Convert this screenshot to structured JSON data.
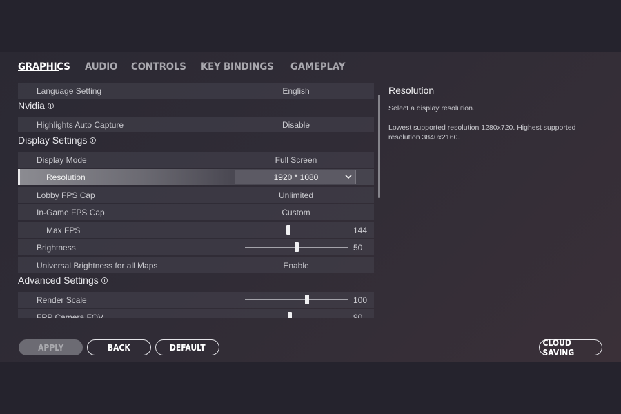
{
  "tabs": [
    {
      "label": "GRAPHICS",
      "active": true
    },
    {
      "label": "AUDIO"
    },
    {
      "label": "CONTROLS"
    },
    {
      "label": "KEY BINDINGS"
    },
    {
      "label": "GAMEPLAY"
    }
  ],
  "settings": {
    "language": {
      "label": "Language Setting",
      "value": "English"
    },
    "nvidia_header": "Nvidia",
    "highlights": {
      "label": "Highlights Auto Capture",
      "value": "Disable"
    },
    "display_header": "Display Settings",
    "display_mode": {
      "label": "Display Mode",
      "value": "Full Screen"
    },
    "resolution": {
      "label": "Resolution",
      "value": "1920 * 1080"
    },
    "lobby_fps": {
      "label": "Lobby FPS Cap",
      "value": "Unlimited"
    },
    "ingame_fps": {
      "label": "In-Game FPS Cap",
      "value": "Custom"
    },
    "max_fps": {
      "label": "Max FPS",
      "value": "144",
      "fraction": 0.42
    },
    "brightness": {
      "label": "Brightness",
      "value": "50",
      "fraction": 0.5
    },
    "universal_brightness": {
      "label": "Universal Brightness for all Maps",
      "value": "Enable"
    },
    "advanced_header": "Advanced Settings",
    "render_scale": {
      "label": "Render Scale",
      "value": "100",
      "fraction": 0.6
    },
    "fpp_fov": {
      "label": "FPP Camera FOV",
      "value": "90",
      "fraction": 0.43
    }
  },
  "detail": {
    "title": "Resolution",
    "line1": "Select a display resolution.",
    "line2": "Lowest supported resolution 1280x720. Highest supported resolution 3840x2160."
  },
  "buttons": {
    "apply": "APPLY",
    "back": "BACK",
    "default": "DEFAULT",
    "cloud": "CLOUD SAVING"
  },
  "colors": {
    "background": "#2b2933",
    "row": "#46444e",
    "selected_row": "#8c8c92",
    "text": "#c9c9ce",
    "active_tab": "#ffffff",
    "inactive_tab": "#a9a8ae"
  }
}
